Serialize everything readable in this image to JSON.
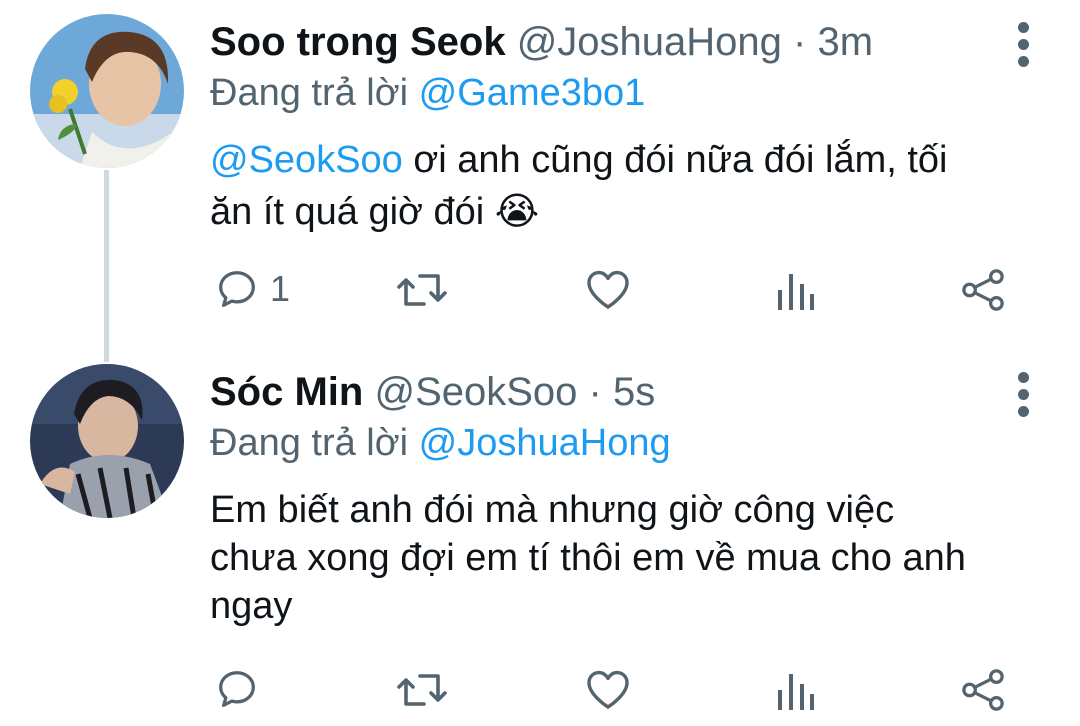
{
  "tweets": [
    {
      "display_name": "Soo trong Seok",
      "handle": "@JoshuaHong",
      "dot": "·",
      "time": "3m",
      "replying_prefix": "Đang trả lời",
      "replying_to": "@Game3bo1",
      "mention": "@SeokSoo",
      "text_line1_rest": " ơi anh cũng đói nữa đói lắm, tối",
      "text_line2": "ăn ít quá giờ đói",
      "emoji": "😭",
      "reply_count": "1"
    },
    {
      "display_name": "Sóc Min",
      "handle": "@SeokSoo",
      "dot": "·",
      "time": "5s",
      "replying_prefix": "Đang trả lời",
      "replying_to": "@JoshuaHong",
      "text_line1": "Em biết anh đói mà nhưng giờ công việc",
      "text_line2": "chưa xong đợi em tí thôi em về mua cho anh",
      "text_line3": "ngay",
      "reply_count": ""
    }
  ],
  "icons": [
    "reply-icon",
    "retweet-icon",
    "like-icon",
    "analytics-icon",
    "share-icon",
    "more-icon"
  ],
  "colors": {
    "link": "#1d9bf0",
    "secondary": "#536471",
    "text": "#0f1419",
    "thread_line": "#cfd9de"
  }
}
